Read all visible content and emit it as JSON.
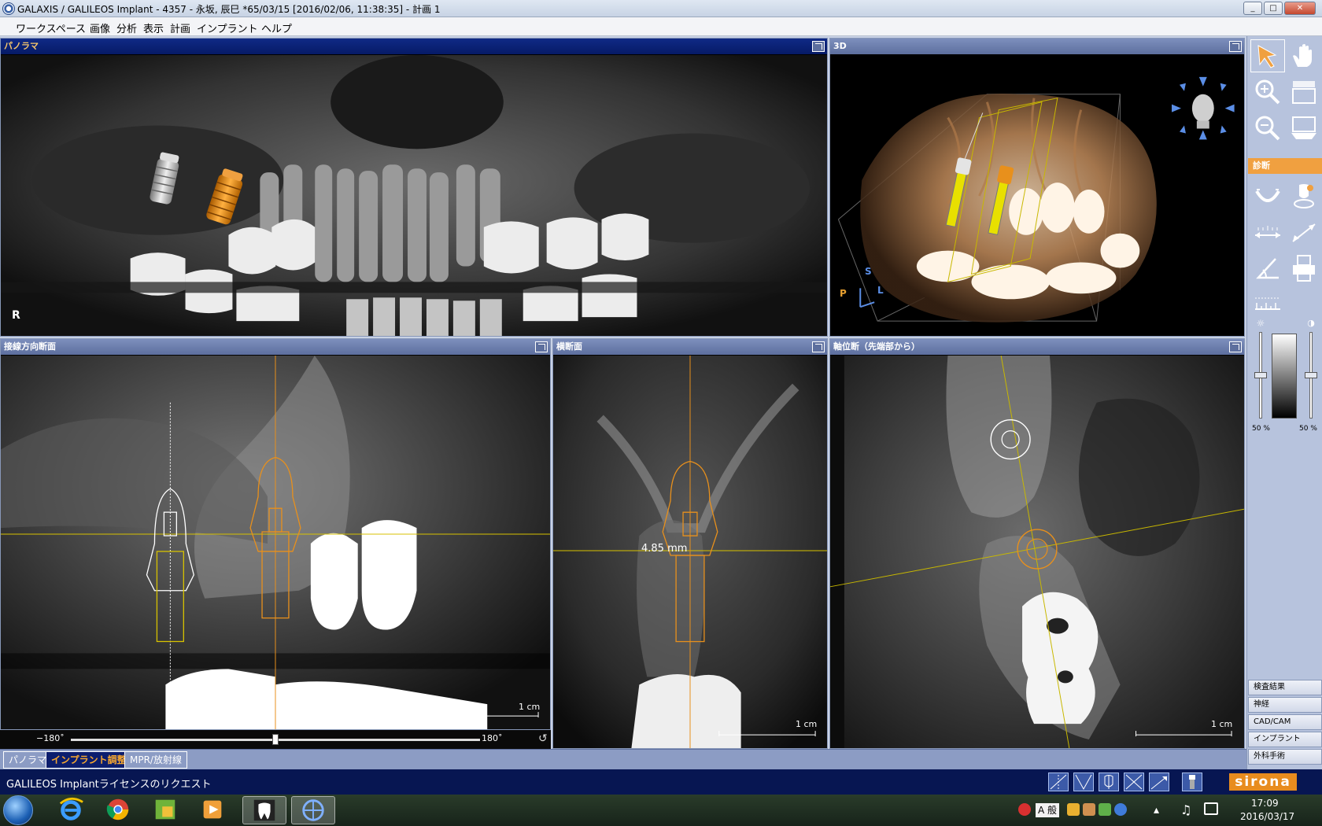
{
  "window": {
    "title": "GALAXIS / GALILEOS Implant - 4357 - 永坂, 辰巳 *65/03/15 [2016/02/06, 11:38:35] - 計画 1",
    "min": "_",
    "max": "□",
    "close": "✕"
  },
  "menu": [
    "ワークスペース",
    "画像",
    "分析",
    "表示",
    "計画",
    "インプラント",
    "ヘルプ"
  ],
  "panels": {
    "panorama": {
      "title": "パノラマ",
      "orientation": "R"
    },
    "view3d": {
      "title": "3D",
      "axis_s": "S",
      "axis_p": "P",
      "axis_l": "L"
    },
    "tangential": {
      "title": "接線方向断面",
      "scale": "1 cm"
    },
    "transverse": {
      "title": "横断面",
      "scale": "1 cm",
      "measurement": "4.85 mm"
    },
    "axial": {
      "title": "軸位断（先端部から）",
      "scale": "1 cm"
    }
  },
  "rotation": {
    "min_label": "−180˚",
    "max_label": "180˚",
    "value": 0.5
  },
  "toolbar": {
    "section": "診断",
    "brightness_pct": "50 %",
    "contrast_pct": "50 %",
    "brightness_value": 0.5,
    "contrast_value": 0.5,
    "side_tabs": [
      "検査結果",
      "神経",
      "CAD/CAM",
      "インプラント",
      "外科手術"
    ]
  },
  "bottom_tabs": [
    {
      "label": "パノラマ",
      "active": false
    },
    {
      "label": "インプラント調整",
      "active": true
    },
    {
      "label": "MPR/放射線",
      "active": false
    }
  ],
  "status": {
    "message": "GALILEOS Implantライセンスのリクエスト",
    "brand": "sirona"
  },
  "taskbar": {
    "time": "17:09",
    "date": "2016/03/17",
    "ime": "A 般"
  },
  "colors": {
    "accent_orange": "#f0a040",
    "header_blue": "#5d6f9e",
    "active_header": "#061a66",
    "implant_orange": "#e8901c",
    "guide_yellow": "#d7c200"
  }
}
